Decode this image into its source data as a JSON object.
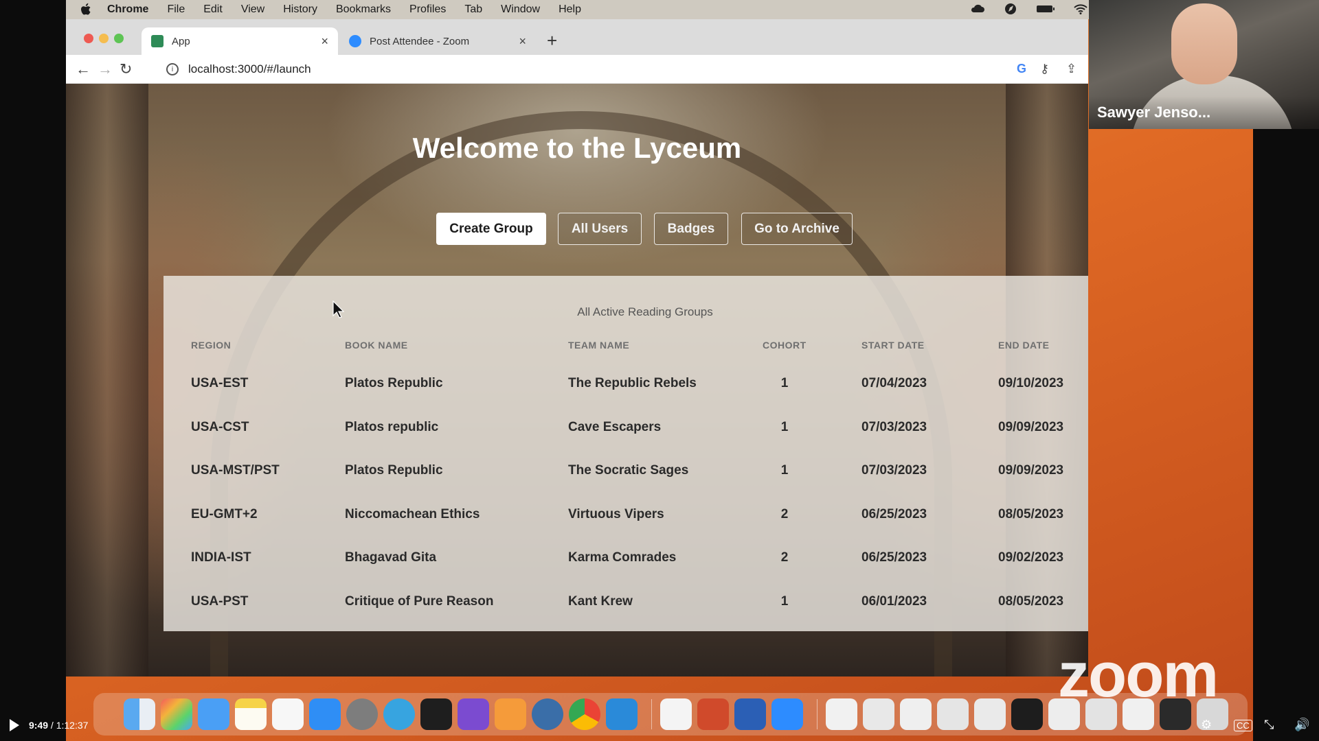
{
  "menubar": {
    "items": [
      "Chrome",
      "File",
      "Edit",
      "View",
      "History",
      "Bookmarks",
      "Profiles",
      "Tab",
      "Window",
      "Help"
    ]
  },
  "browser": {
    "tabs": [
      {
        "label": "App",
        "favicon_color": "#2e8b57"
      },
      {
        "label": "Post Attendee - Zoom",
        "favicon_color": "#2d8cff"
      }
    ],
    "url": "localhost:3000/#/launch"
  },
  "page": {
    "title": "Welcome to the Lyceum",
    "buttons": [
      "Create Group",
      "All Users",
      "Badges",
      "Go to Archive"
    ],
    "table": {
      "caption": "All Active Reading Groups",
      "columns": [
        "REGION",
        "BOOK NAME",
        "TEAM NAME",
        "COHORT",
        "START DATE",
        "END DATE"
      ],
      "rows": [
        [
          "USA-EST",
          "Platos Republic",
          "The Republic Rebels",
          "1",
          "07/04/2023",
          "09/10/2023"
        ],
        [
          "USA-CST",
          "Platos republic",
          "Cave Escapers",
          "1",
          "07/03/2023",
          "09/09/2023"
        ],
        [
          "USA-MST/PST",
          "Platos Republic",
          "The Socratic Sages",
          "1",
          "07/03/2023",
          "09/09/2023"
        ],
        [
          "EU-GMT+2",
          "Niccomachean Ethics",
          "Virtuous Vipers",
          "2",
          "06/25/2023",
          "08/05/2023"
        ],
        [
          "INDIA-IST",
          "Bhagavad Gita",
          "Karma Comrades",
          "2",
          "06/25/2023",
          "09/02/2023"
        ],
        [
          "USA-PST",
          "Critique of Pure Reason",
          "Kant Krew",
          "1",
          "06/01/2023",
          "08/05/2023"
        ]
      ]
    }
  },
  "zoom": {
    "participant_name": "Sawyer Jenso...",
    "logo": "zoom"
  },
  "player": {
    "current_time": "9:49",
    "separator": " / ",
    "total_time": "1:12:37"
  },
  "dock": {
    "icons": [
      "finder-icon",
      "launchpad-icon",
      "mail-icon",
      "notes-icon",
      "reminders-icon",
      "app-store-icon",
      "system-settings-icon",
      "telegram-icon",
      "terminal-icon",
      "github-desktop-icon",
      "pencil-app-icon",
      "postgres-icon",
      "chrome-icon",
      "vscode-icon",
      "slack-icon",
      "powerpoint-icon",
      "word-icon",
      "zoom-icon"
    ]
  }
}
